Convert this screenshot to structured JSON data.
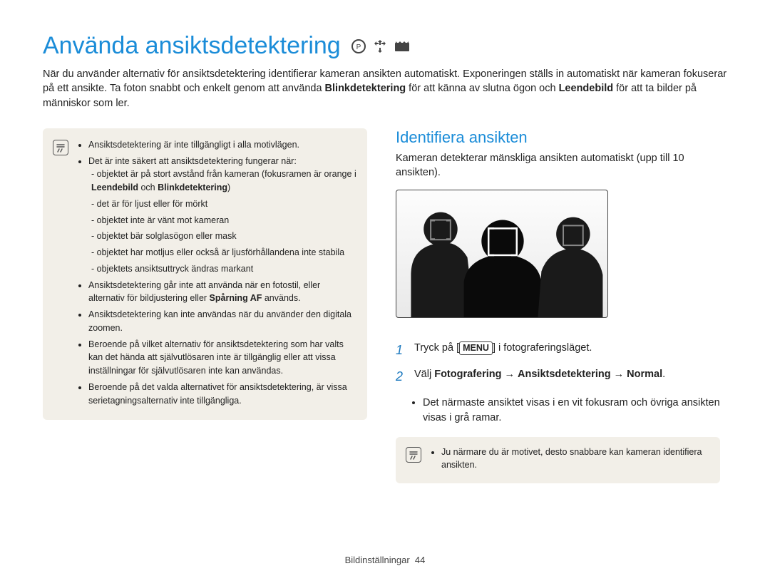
{
  "title": "Använda ansiktsdetektering",
  "intro": {
    "part1": "När du använder alternativ för ansiktsdetektering identifierar kameran ansikten automatiskt. Exponeringen ställs in automatiskt när kameran fokuserar på ett ansikte. Ta foton snabbt och enkelt genom att använda ",
    "bold1": "Blinkdetektering",
    "part2": " för att känna av slutna ögon och ",
    "bold2": "Leendebild",
    "part3": " för att ta bilder på människor som ler."
  },
  "note_glyph": "✓",
  "note1": {
    "li1": "Ansiktsdetektering är inte tillgängligt i alla motivlägen.",
    "li2": "Det är inte säkert att ansiktsdetektering fungerar när:",
    "sub1a": "objektet är på stort avstånd från kameran (fokusramen är orange i ",
    "sub1b_bold1": "Leendebild",
    "sub1b_mid": " och ",
    "sub1b_bold2": "Blinkdetektering",
    "sub1b_end": ")",
    "sub2": "det är för ljust eller för mörkt",
    "sub3": "objektet inte är vänt mot kameran",
    "sub4": "objektet bär solglasögon eller mask",
    "sub5": "objektet har motljus eller också är ljusförhållandena inte stabila",
    "sub6": "objektets ansiktsuttryck ändras markant",
    "li3a": "Ansiktsdetektering går inte att använda när en fotostil, eller alternativ för bildjustering eller ",
    "li3b_bold": "Spårning AF",
    "li3c": " används.",
    "li4": "Ansiktsdetektering kan inte användas när du använder den digitala zoomen.",
    "li5": "Beroende på vilket alternativ för ansiktsdetektering som har valts kan det hända att självutlösaren inte är tillgänglig eller att vissa inställningar för självutlösaren inte kan användas.",
    "li6": "Beroende på det valda alternativet för ansiktsdetektering, är vissa serietagningsalternativ inte tillgängliga."
  },
  "right": {
    "heading": "Identifiera ansikten",
    "text": "Kameran detekterar mänskliga ansikten automatiskt (upp till 10 ansikten).",
    "step1_a": "Tryck på [",
    "step1_menu": "MENU",
    "step1_b": "] i fotograferingsläget.",
    "step2_a": "Välj ",
    "step2_b": "Fotografering",
    "step2_arrow1": " → ",
    "step2_c": "Ansiktsdetektering",
    "step2_arrow2": " → ",
    "step2_d": "Normal",
    "step2_e": ".",
    "sub": "Det närmaste ansiktet visas i en vit fokusram och övriga ansikten visas i grå ramar.",
    "note2": "Ju närmare du är motivet, desto snabbare kan kameran identifiera ansikten."
  },
  "footer_section": "Bildinställningar",
  "footer_page": "44"
}
